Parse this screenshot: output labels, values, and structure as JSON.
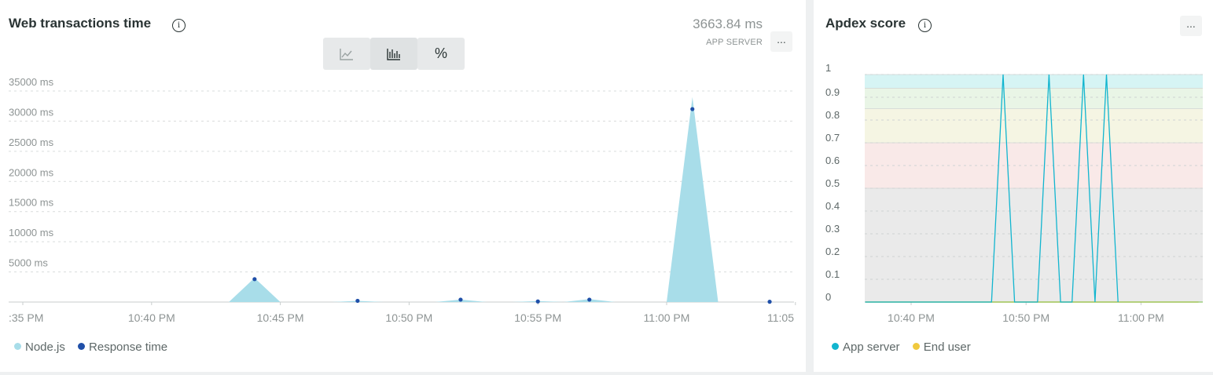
{
  "left": {
    "title": "Web transactions time",
    "summary_value": "3663.84 ms",
    "summary_label": "APP SERVER",
    "more_label": "...",
    "toggles": [
      {
        "name": "area-chart-toggle",
        "icon": "area-chart-icon"
      },
      {
        "name": "bar-chart-toggle",
        "icon": "bar-chart-icon",
        "active": true
      },
      {
        "name": "percent-toggle",
        "label": "%"
      }
    ],
    "legend": [
      {
        "label": "Node.js",
        "color": "#a8dde9"
      },
      {
        "label": "Response time",
        "color": "#1f4fa8"
      }
    ]
  },
  "right": {
    "title": "Apdex score",
    "more_label": "...",
    "legend": [
      {
        "label": "App server",
        "color": "#11b5cf"
      },
      {
        "label": "End user",
        "color": "#f0c93e"
      }
    ]
  },
  "chart_data": [
    {
      "type": "area",
      "title": "Web transactions time",
      "y_unit": "ms",
      "yticks": [
        "35000 ms",
        "30000 ms",
        "25000 ms",
        "20000 ms",
        "15000 ms",
        "10000 ms",
        "5000 ms"
      ],
      "ylim": [
        0,
        35000
      ],
      "xticks": [
        ":35 PM",
        "10:40 PM",
        "10:45 PM",
        "10:50 PM",
        "10:55 PM",
        "11:00 PM",
        "11:05"
      ],
      "xlim": [
        "10:35 PM",
        "11:05 PM"
      ],
      "grid": true,
      "series": [
        {
          "name": "Node.js",
          "color": "#a8dde9",
          "x": [
            "10:43 PM",
            "10:44 PM",
            "10:45 PM",
            "10:47 PM",
            "10:48 PM",
            "10:49 PM",
            "10:51 PM",
            "10:52 PM",
            "10:53 PM",
            "10:54 PM",
            "10:55 PM",
            "10:56 PM",
            "10:57 PM",
            "10:58 PM",
            "11:00 PM",
            "11:01 PM",
            "11:02 PM"
          ],
          "values": [
            0,
            4000,
            0,
            0,
            200,
            0,
            0,
            400,
            0,
            0,
            150,
            0,
            500,
            0,
            0,
            34000,
            0
          ]
        },
        {
          "name": "Response time",
          "color": "#1f4fa8",
          "x": [
            "10:44 PM",
            "10:48 PM",
            "10:52 PM",
            "10:55 PM",
            "10:57 PM",
            "11:01 PM",
            "11:04 PM"
          ],
          "values": [
            3800,
            200,
            400,
            100,
            400,
            32000,
            50
          ]
        }
      ],
      "legend": "bottom-left"
    },
    {
      "type": "line",
      "title": "Apdex score",
      "yticks": [
        "1",
        "0.9",
        "0.8",
        "0.7",
        "0.6",
        "0.5",
        "0.4",
        "0.3",
        "0.2",
        "0.1",
        "0"
      ],
      "ylim": [
        0,
        1
      ],
      "xticks": [
        "10:40 PM",
        "10:50 PM",
        "11:00 PM"
      ],
      "bands": [
        {
          "from": 0.94,
          "to": 1.0,
          "color": "#d6f4f4"
        },
        {
          "from": 0.85,
          "to": 0.94,
          "color": "#e9f5e6"
        },
        {
          "from": 0.7,
          "to": 0.85,
          "color": "#f5f5e3"
        },
        {
          "from": 0.5,
          "to": 0.7,
          "color": "#f9e9e8"
        },
        {
          "from": 0.0,
          "to": 0.5,
          "color": "#eaeaea"
        }
      ],
      "series": [
        {
          "name": "App server",
          "color": "#11b5cf",
          "x": [
            "10:47 PM",
            "10:48 PM",
            "10:49 PM",
            "10:51 PM",
            "10:52 PM",
            "10:53 PM",
            "10:54 PM",
            "10:55 PM",
            "10:56 PM",
            "10:56 PM",
            "10:57 PM",
            "10:58 PM"
          ],
          "values": [
            0,
            1,
            0,
            0,
            1,
            0,
            0,
            1,
            0,
            0,
            1,
            0
          ]
        },
        {
          "name": "End user",
          "color": "#f0c93e",
          "x": [
            "10:36 PM",
            "11:05 PM"
          ],
          "values": [
            0,
            0
          ]
        }
      ],
      "legend": "bottom-left"
    }
  ]
}
